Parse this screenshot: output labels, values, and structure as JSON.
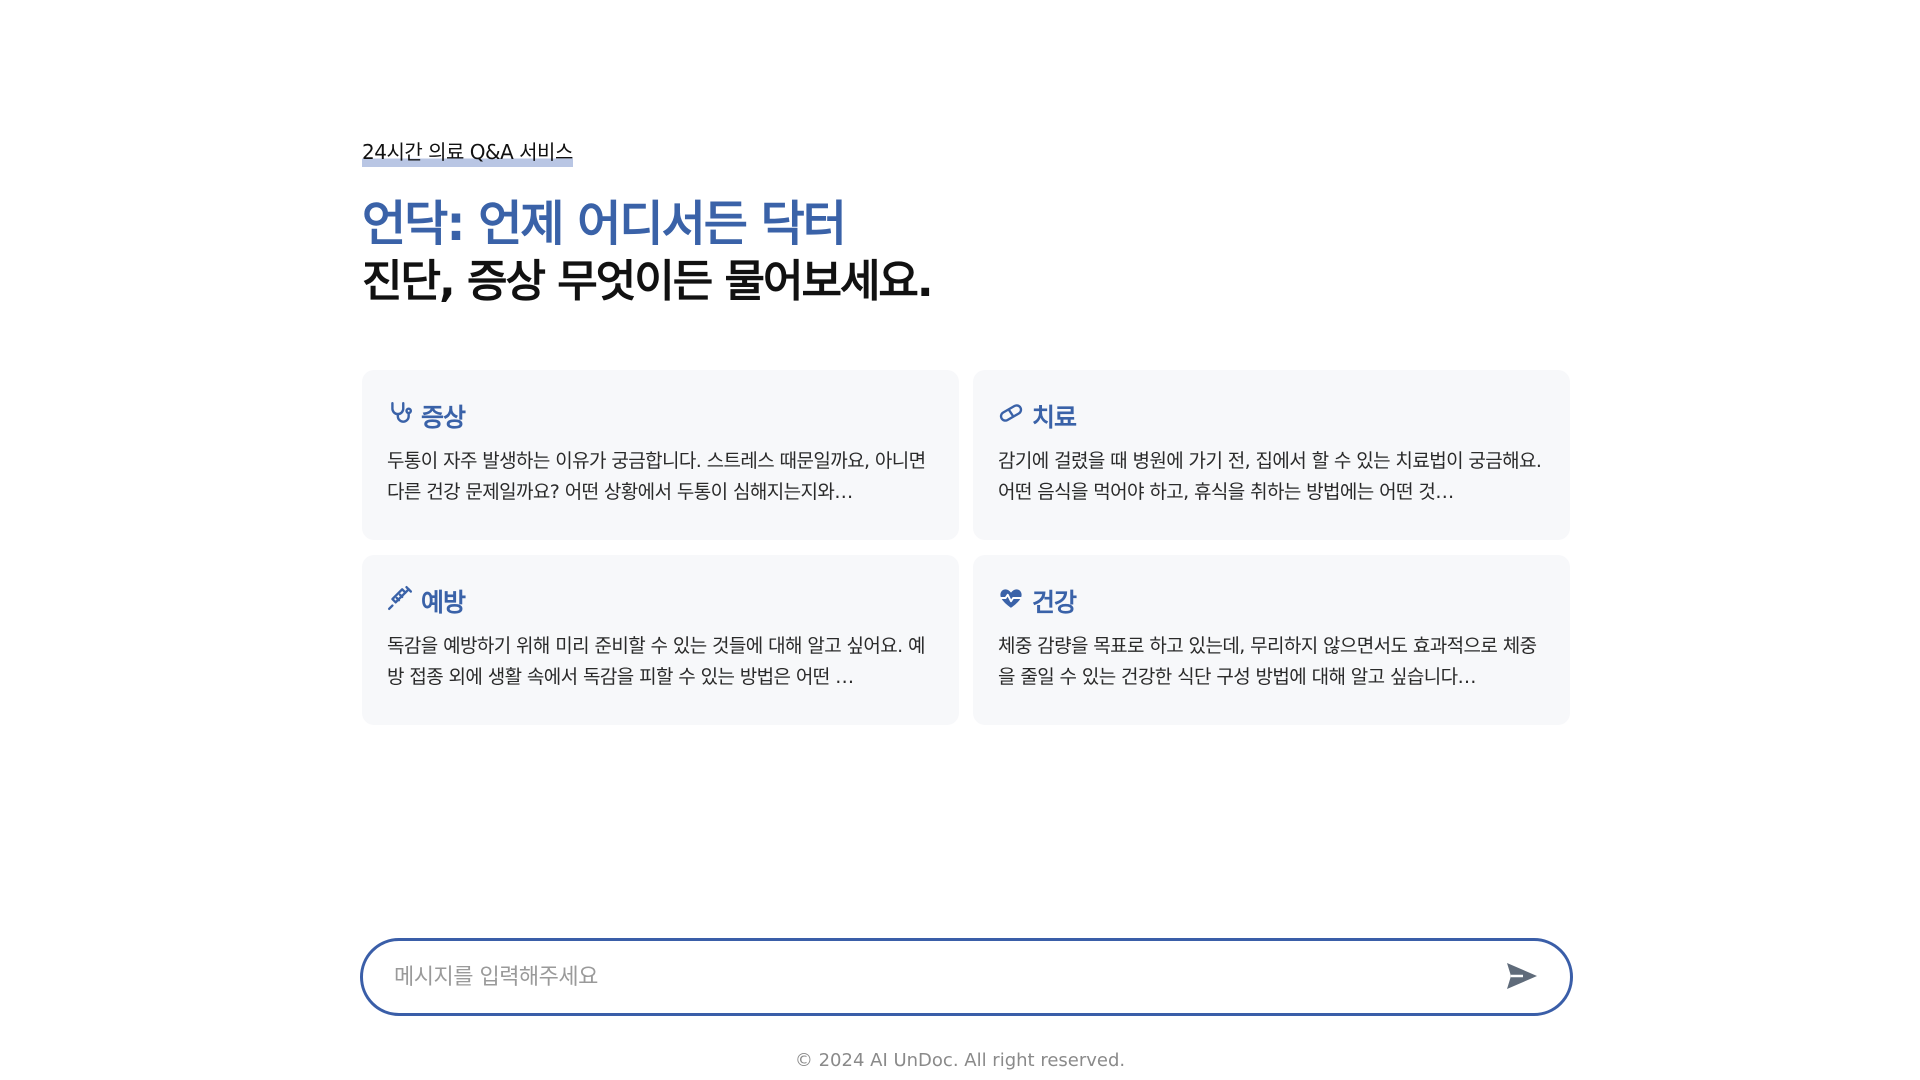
{
  "hero": {
    "tagline": "24시간 의료 Q&A 서비스",
    "title_line1": "언닥: 언제 어디서든 닥터",
    "title_line2": "진단, 증상 무엇이든 물어보세요."
  },
  "cards": [
    {
      "icon": "stethoscope-icon",
      "title": "증상",
      "text": "두통이 자주 발생하는 이유가 궁금합니다. 스트레스 때문일까요, 아니면 다른 건강 문제일까요? 어떤 상황에서 두통이 심해지는지와…"
    },
    {
      "icon": "pill-icon",
      "title": "치료",
      "text": "감기에 걸렸을 때 병원에 가기 전, 집에서 할 수 있는 치료법이 궁금해요. 어떤 음식을 먹어야 하고, 휴식을 취하는 방법에는 어떤 것…"
    },
    {
      "icon": "syringe-icon",
      "title": "예방",
      "text": "독감을 예방하기 위해 미리 준비할 수 있는 것들에 대해 알고 싶어요. 예방 접종 외에 생활 속에서 독감을 피할 수 있는 방법은 어떤 …"
    },
    {
      "icon": "heart-pulse-icon",
      "title": "건강",
      "text": "체중 감량을 목표로 하고 있는데, 무리하지 않으면서도 효과적으로 체중을 줄일 수 있는 건강한 식단 구성 방법에 대해 알고 싶습니다…"
    }
  ],
  "input": {
    "placeholder": "메시지를 입력해주세요",
    "value": "",
    "send_icon": "send-icon"
  },
  "footer": {
    "text": "© 2024 AI UnDoc. All right reserved."
  },
  "colors": {
    "accent": "#3a62a8",
    "card_bg": "#f7f8fa",
    "input_border": "#3a5ea8",
    "tagline_highlight": "#b9c6e4"
  }
}
